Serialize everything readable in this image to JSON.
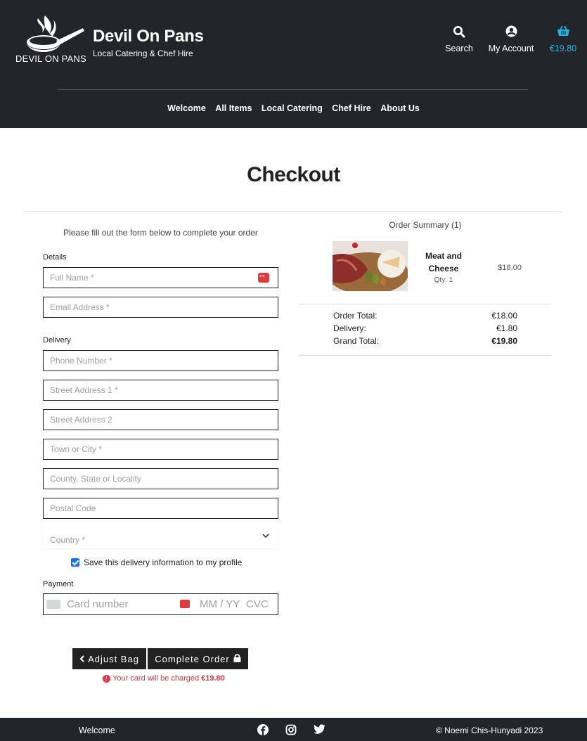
{
  "brand": {
    "logo_text": "DEVIL ON PANS",
    "name": "Devil On Pans",
    "tagline": "Local Catering & Chef Hire"
  },
  "header_nav": {
    "search": {
      "label": "Search",
      "icon": "search-icon"
    },
    "account": {
      "label": "My Account",
      "icon": "user-circle-icon"
    },
    "bag": {
      "label": "€19.80",
      "icon": "basket-icon",
      "color": "#1fb6e0"
    }
  },
  "main_nav": [
    "Welcome",
    "All Items",
    "Local Catering",
    "Chef Hire",
    "About Us"
  ],
  "checkout": {
    "title": "Checkout",
    "intro": "Please fill out the form below to complete your order",
    "details_label": "Details",
    "delivery_label": "Delivery",
    "payment_label": "Payment",
    "fields": {
      "full_name": "Full Name *",
      "email": "Email Address *",
      "phone": "Phone Number *",
      "street1": "Street Address 1 *",
      "street2": "Street Address 2",
      "town": "Town or City *",
      "county": "County, State or Locality",
      "postcode": "Postal Code",
      "country": "Country *"
    },
    "save_info": {
      "label": "Save this delivery information to my profile",
      "checked": true
    },
    "card": {
      "number": "Card number",
      "expiry": "MM / YY",
      "cvc": "CVC"
    },
    "adjust_button": "Adjust Bag",
    "complete_button": "Complete Order",
    "charge_note": "Your card will be charged",
    "charge_amount": "€19.80"
  },
  "summary": {
    "title": "Order Summary (1)",
    "item": {
      "name": "Meat and Cheese",
      "qty": "Qty: 1",
      "price": "$18.00"
    },
    "order_total_label": "Order Total:",
    "order_total": "€18.00",
    "delivery_label": "Delivery:",
    "delivery": "€1.80",
    "grand_total_label": "Grand Total:",
    "grand_total": "€19.80"
  },
  "footer": {
    "welcome": "Welcome",
    "social": [
      "facebook-icon",
      "instagram-icon",
      "twitter-icon"
    ],
    "copyright": "© Noemi Chis-Hunyadi 2023"
  },
  "colors": {
    "header_bg": "#22252a",
    "accent": "#1fb6e0",
    "error": "#dc3545",
    "button_bg": "#222222"
  }
}
